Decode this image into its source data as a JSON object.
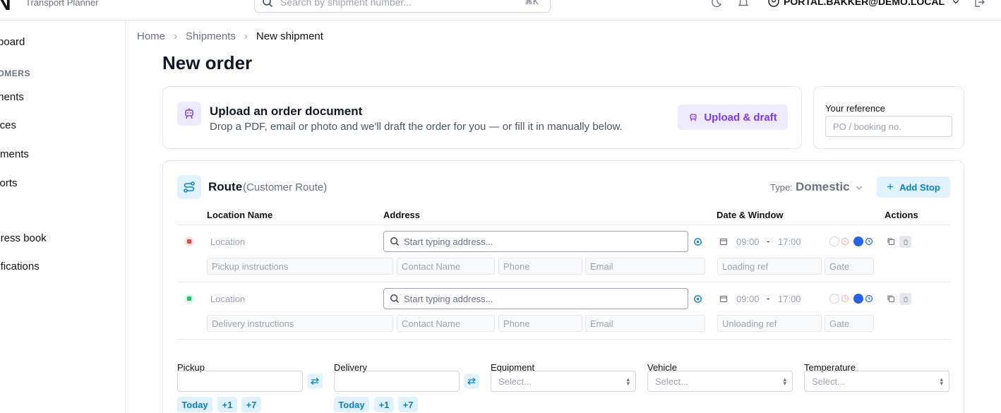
{
  "app": {
    "logo": "N",
    "subtitle": "Transport Planner"
  },
  "search": {
    "placeholder": "Search by shipment number...",
    "shortcut": "⌘K"
  },
  "user": {
    "email": "PORTAL.BAKKER@DEMO.LOCAL"
  },
  "sidebar": {
    "items": [
      {
        "label": "Dashboard"
      },
      {
        "label": "Shipments"
      },
      {
        "label": "Invoices"
      },
      {
        "label": "Documents"
      },
      {
        "label": "Reports"
      },
      {
        "label": "Address book"
      },
      {
        "label": "Notifications"
      }
    ],
    "section_label": "CUSTOMERS"
  },
  "breadcrumb": {
    "home": "Home",
    "shipments": "Shipments",
    "current": "New shipment"
  },
  "page": {
    "title": "New order"
  },
  "upload": {
    "title": "Upload an order document",
    "description": "Drop a PDF, email or photo and we'll draft the order for you — or fill it in manually below.",
    "button": "Upload & draft"
  },
  "reference": {
    "label": "Your reference",
    "placeholder": "PO / booking no."
  },
  "route": {
    "title": "Route",
    "subtitle": "(Customer Route)",
    "type_label": "Type:",
    "type_value": "Domestic",
    "add_stop": "Add Stop",
    "columns": {
      "location": "Location Name",
      "address": "Address",
      "date": "Date & Window",
      "actions": "Actions"
    },
    "stops": [
      {
        "kind": "pickup",
        "color": "#ef4444",
        "location_placeholder": "Location",
        "address_placeholder": "Start typing address...",
        "time_from": "09:00",
        "time_sep": "-",
        "time_to": "17:00",
        "instructions_placeholder": "Pickup instructions",
        "contact_placeholder": "Contact Name",
        "phone_placeholder": "Phone",
        "email_placeholder": "Email",
        "ref_placeholder": "Loading ref",
        "gate_placeholder": "Gate"
      },
      {
        "kind": "delivery",
        "color": "#22c55e",
        "location_placeholder": "Location",
        "address_placeholder": "Start typing address...",
        "time_from": "09:00",
        "time_sep": "-",
        "time_to": "17:00",
        "instructions_placeholder": "Delivery instructions",
        "contact_placeholder": "Contact Name",
        "phone_placeholder": "Phone",
        "email_placeholder": "Email",
        "ref_placeholder": "Unloading ref",
        "gate_placeholder": "Gate"
      }
    ]
  },
  "form": {
    "pickup_label": "Pickup",
    "delivery_label": "Delivery",
    "equipment_label": "Equipment",
    "vehicle_label": "Vehicle",
    "temperature_label": "Temperature",
    "select_placeholder": "Select...",
    "chips": [
      "Today",
      "+1",
      "+7"
    ]
  },
  "colors": {
    "accent": "#0284c7",
    "purple": "#7c3aed"
  }
}
